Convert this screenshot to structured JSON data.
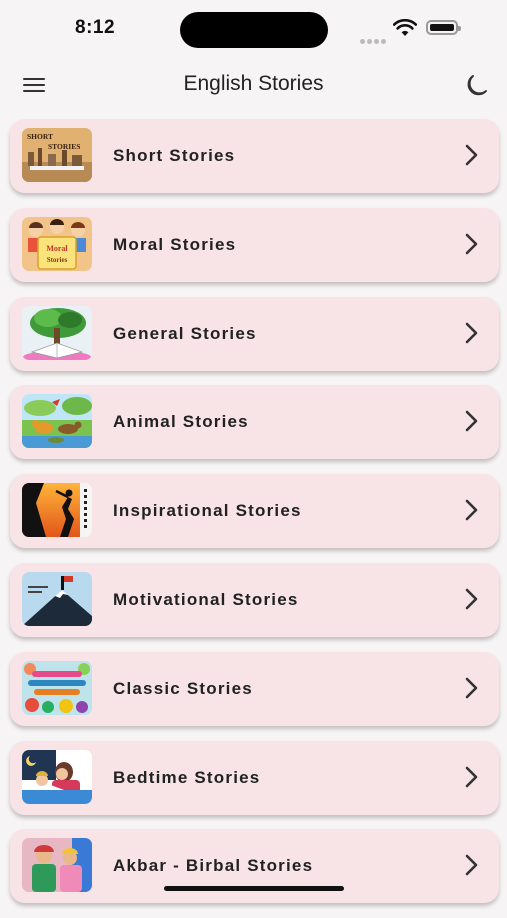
{
  "status": {
    "time": "8:12"
  },
  "header": {
    "title": "English Stories"
  },
  "thumb_text": {
    "short": "SHORT",
    "stories": "STORIES",
    "moral": "Moral",
    "moral2": "Stories"
  },
  "stories": [
    {
      "label": "Short Stories",
      "icon": "short-stories-thumbnail"
    },
    {
      "label": "Moral Stories",
      "icon": "moral-stories-thumbnail"
    },
    {
      "label": "General Stories",
      "icon": "general-stories-thumbnail"
    },
    {
      "label": "Animal Stories",
      "icon": "animal-stories-thumbnail"
    },
    {
      "label": "Inspirational Stories",
      "icon": "inspirational-stories-thumbnail"
    },
    {
      "label": "Motivational Stories",
      "icon": "motivational-stories-thumbnail"
    },
    {
      "label": "Classic Stories",
      "icon": "classic-stories-thumbnail"
    },
    {
      "label": "Bedtime Stories",
      "icon": "bedtime-stories-thumbnail"
    },
    {
      "label": "Akbar - Birbal Stories",
      "icon": "akbar-birbal-stories-thumbnail"
    }
  ],
  "colors": {
    "card": "#f8e4e7",
    "background": "#f7f4f5",
    "text": "#222222"
  }
}
